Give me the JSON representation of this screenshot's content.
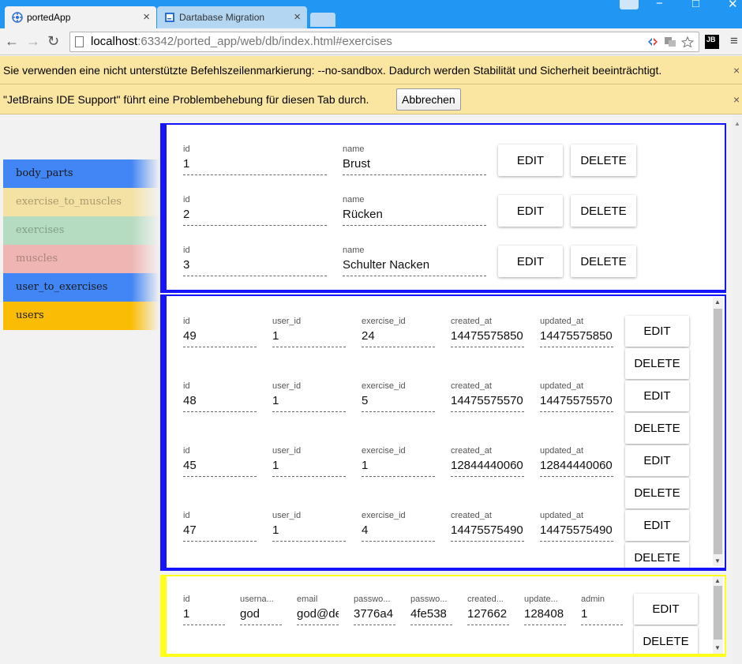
{
  "browser": {
    "tabs": [
      {
        "title": "portedApp",
        "close": "×"
      },
      {
        "title": "Dartabase Migration",
        "close": "×"
      }
    ],
    "window_controls": {
      "minimize": "−",
      "maximize": "□",
      "close": "✕"
    },
    "nav": {
      "back": "←",
      "forward": "→",
      "reload": "↻"
    },
    "url_host": "localhost",
    "url_rest": ":63342/ported_app/web/db/index.html#exercises",
    "jb_badge": "JB",
    "menu": "≡",
    "accent": "#2196f3"
  },
  "infobars": {
    "sandbox_warning": "Sie verwenden eine nicht unterstützte Befehlszeilenmarkierung: --no-sandbox. Dadurch werden Stabilität und Sicherheit beeinträchtigt.",
    "jetbrains_notice": "\"JetBrains IDE Support\" führt eine Problembehebung für diesen Tab durch.",
    "cancel_label": "Abbrechen",
    "close": "×"
  },
  "sidebar": {
    "items": [
      {
        "label": "body_parts",
        "color": "#4285f4"
      },
      {
        "label": "exercise_to_muscles",
        "color": "#f4e1a4"
      },
      {
        "label": "exercises",
        "color": "#b5dbc0"
      },
      {
        "label": "muscles",
        "color": "#eeb5b2"
      },
      {
        "label": "user_to_exercises",
        "color": "#4285f4"
      },
      {
        "label": "users",
        "color": "#fbbc05"
      }
    ]
  },
  "buttons": {
    "edit": "EDIT",
    "delete": "DELETE"
  },
  "body_parts": {
    "border_color": "#1515ff",
    "columns": [
      "id",
      "name"
    ],
    "rows": [
      {
        "id": "1",
        "name": "Brust"
      },
      {
        "id": "2",
        "name": "Rücken"
      },
      {
        "id": "3",
        "name": "Schulter Nacken"
      }
    ]
  },
  "user_to_exercises": {
    "border_color": "#1515ff",
    "columns": [
      "id",
      "user_id",
      "exercise_id",
      "created_at",
      "updated_at"
    ],
    "rows": [
      {
        "id": "49",
        "user_id": "1",
        "exercise_id": "24",
        "created_at": "14475575850",
        "updated_at": "14475575850"
      },
      {
        "id": "48",
        "user_id": "1",
        "exercise_id": "5",
        "created_at": "14475575570",
        "updated_at": "14475575570"
      },
      {
        "id": "45",
        "user_id": "1",
        "exercise_id": "1",
        "created_at": "12844440060",
        "updated_at": "12844440060"
      },
      {
        "id": "47",
        "user_id": "1",
        "exercise_id": "4",
        "created_at": "14475575490",
        "updated_at": "14475575490"
      }
    ]
  },
  "users": {
    "border_color": "#ffff1a",
    "columns": [
      "id",
      "userna...",
      "email",
      "passwo...",
      "passwo...",
      "created...",
      "update...",
      "admin"
    ],
    "rows": [
      {
        "id": "1",
        "username": "god",
        "email": "god@de",
        "password": "3776a4",
        "password2": "4fe538",
        "created_at": "127662",
        "updated_at": "128408",
        "admin": "1"
      }
    ]
  }
}
